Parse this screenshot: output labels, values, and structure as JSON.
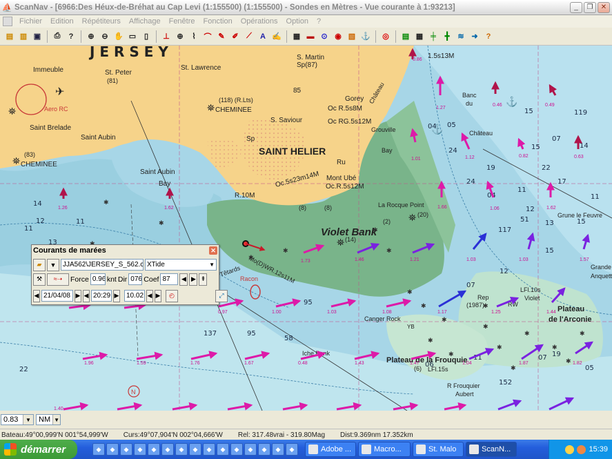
{
  "window": {
    "title": "ScanNav - [6966:Des Héux-de-Bréhat au Cap Levi (1:155500) (1:155500) - Sondes en  Mètres  - Vue courante à 1:93213]"
  },
  "menu": [
    "Fichier",
    "Edition",
    "Répétiteurs",
    "Affichage",
    "Fenêtre",
    "Fonction",
    "Opérations",
    "Option",
    "?"
  ],
  "map": {
    "places": {
      "jersey": "J E R S E Y",
      "immeuble": "Immeuble",
      "st_peter": "St. Peter",
      "st_peter_num": "(81)",
      "st_lawrence": "St. Lawrence",
      "st_martin": "S. Martin",
      "st_martin_sp": "Sp(87)",
      "aero_rc": "Aero RC",
      "cheminee1": "CHEMINEE",
      "cheminee1_light": "(118) (R.Lts)",
      "st_saviour": "S. Saviour",
      "gorey": "Gorey",
      "gorey_light1": "Oc R.5s8M",
      "gorey_light2": "Oc RG.5s12M",
      "saint_brelade": "Saint Brelade",
      "saint_aubin": "Saint Aubin",
      "saint_helier": "SAINT HELIER",
      "sp": "Sp",
      "cheminee2": "CHEMINEE",
      "cheminee2_num": "(83)",
      "ru": "Ru",
      "st_aubin_bay1": "Saint Aubin",
      "st_aubin_bay2": "Bay",
      "mont_ube": "Mont Ubé",
      "mont_ube_light": "Oc.R.5s12M",
      "oc_light": "Oc.5s23m14M",
      "la_rocque": "La Rocque Point",
      "violet_bank": "Violet Bank",
      "canger_rock": "Canger Rock",
      "plateau_frouquie": "Plateau de la Frouquie",
      "plateau_arconie1": "Plateau",
      "plateau_arconie2": "de l'Arconie",
      "grande_anquette1": "Grande",
      "grande_anquette2": "Anquette",
      "grune_le_fevre": "Grune le Feuvre",
      "frouquier_aubert1": "R Frouquier",
      "frouquier_aubert2": "Aubert",
      "racon": "Racon",
      "lfl_violet1": "LFl.10s",
      "lfl_violet2": "Violet",
      "banc_chateau1": "Banc",
      "banc_chateau2": "du",
      "banc_chateau3": "Château",
      "chateau": "Château",
      "grouville": "Grouville",
      "bay": "Bay",
      "tetards": "Têtards",
      "iche_bank": "Iche Bank",
      "num_85": "85",
      "num_8": "(8)",
      "num_2": "(2)",
      "num_14": "(14)",
      "num_20": "(20)",
      "rep": "Rep",
      "rep_year": "(1987)",
      "rw": "RW",
      "yb": "YB",
      "lfl15s": "LFl.15s",
      "light_10m": "R.10M",
      "light_15m": "1.5s13M",
      "light_12m": "Mo(D)WR.12s11M",
      "num_lb": "(6)"
    },
    "soundings": [
      "14",
      "11",
      "12",
      "13",
      "11",
      "22",
      "58",
      "95",
      "137",
      "95",
      "119",
      "05",
      "15",
      "15",
      "19",
      "11",
      "07",
      "04",
      "24",
      "24",
      "22",
      "17",
      "14",
      "12",
      "13",
      "11",
      "15",
      "117",
      "152",
      "07",
      "15",
      "19",
      "11",
      "07",
      "06",
      "04",
      "12",
      "51",
      "05"
    ],
    "current_labels": [
      "0.86",
      "0.46",
      "0.49",
      "0.82",
      "0.63",
      "1.27",
      "1.01",
      "1.12",
      "1.06",
      "1.62",
      "1.66",
      "1.57",
      "1.03",
      "1.03",
      "1.21",
      "1.46",
      "1.73",
      "1.62",
      "1.26",
      "0.97",
      "1.00",
      "1.03",
      "1.08",
      "1.17",
      "1.25",
      "1.44",
      "1.76",
      "1.67",
      "0.48",
      "1.43",
      "1.47",
      "1.04",
      "1.87",
      "1.82",
      "1.40",
      "1.96",
      "1.59"
    ]
  },
  "dialog": {
    "title": "Courants de marées",
    "file": "JJA562\\JERSEY_S_562.cur",
    "source": "XTide",
    "force_label": "Force",
    "force_value": "0.96",
    "force_unit": "knt",
    "dir_label": "Dir",
    "dir_value": "076",
    "coef_label": "Coef",
    "coef_value": "87",
    "date": "21/04/08",
    "time": "20:29",
    "step": "10.02"
  },
  "statusbar": {
    "zoom": "0.83",
    "unit": "NM",
    "boat": "Bateau:49°00,999'N 001°54,999'W",
    "cursor": "Curs:49°07,904'N 002°04,666'W",
    "bearing": "Rel: 317.48vrai - 319.80Mag",
    "distance": "Dist:9.369nm  17.352km"
  },
  "taskbar": {
    "start": "démarrer",
    "tasks": [
      "Adobe ...",
      "Macro...",
      "St. Malo",
      "ScanN..."
    ],
    "clock": "15:39"
  },
  "colors": {
    "land": "#f6d38a",
    "shallow": "#b8dcd0",
    "deep": "#a7d6e7",
    "foreshore": "#79b48a",
    "arrow_magenta": "#dd1aa8",
    "arrow_purple": "#7a22e0",
    "arrow_blue": "#2b30d6",
    "arrow_maroon": "#b0144a"
  }
}
